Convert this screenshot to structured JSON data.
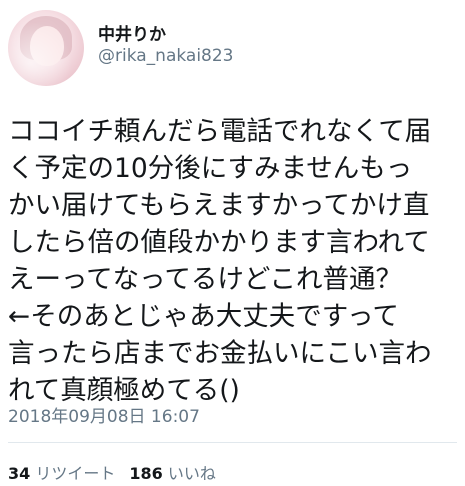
{
  "user": {
    "display_name": "中井りか",
    "handle": "@rika_nakai823"
  },
  "tweet": {
    "lines": [
      "ココイチ頼んだら電話でれなくて届",
      "く予定の10分後にすみませんもっ",
      "かい届けてもらえますかってかけ直",
      "したら倍の値段かかります言われて",
      "えーってなってるけどこれ普通？",
      "←そのあとじゃあ大丈夫ですって",
      "言ったら店までお金払いにこい言わ",
      "れて真顔極めてる()"
    ],
    "timestamp": "2018年09月08日 16:07"
  },
  "stats": {
    "retweets_count": "34",
    "retweets_label": "リツイート",
    "likes_count": "186",
    "likes_label": "いいね"
  }
}
